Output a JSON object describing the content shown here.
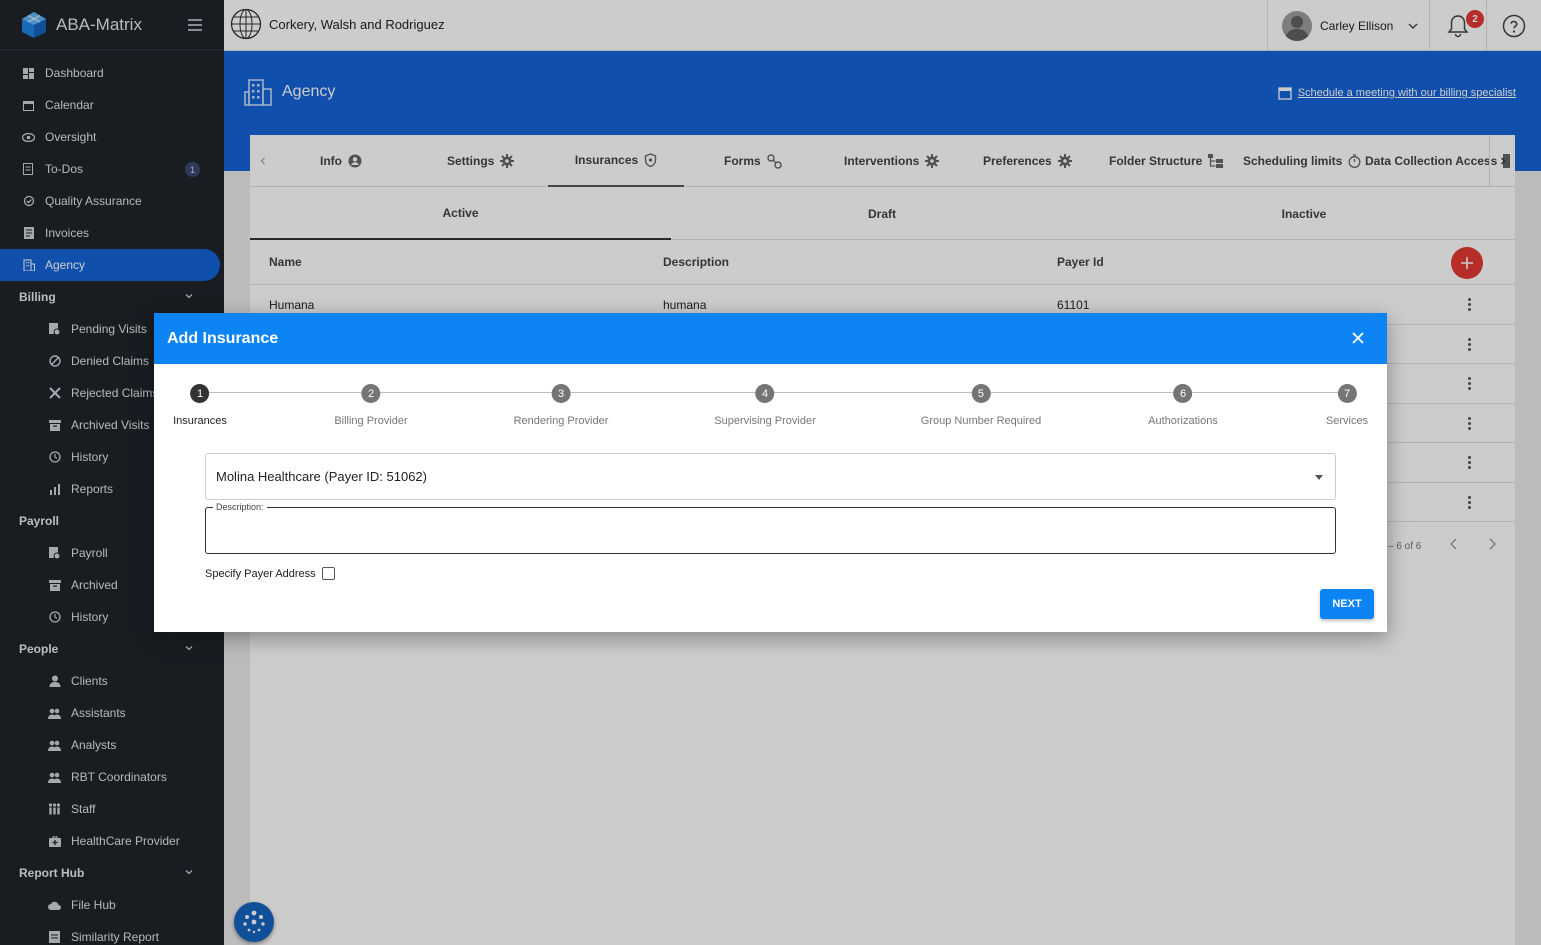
{
  "app": {
    "name": "ABA-Matrix"
  },
  "sidebar": {
    "items": [
      {
        "label": "Dashboard",
        "icon": "dashboard-icon"
      },
      {
        "label": "Calendar",
        "icon": "calendar-icon"
      },
      {
        "label": "Oversight",
        "icon": "eye-icon"
      },
      {
        "label": "To-Dos",
        "icon": "todo-icon",
        "badge": "1"
      },
      {
        "label": "Quality Assurance",
        "icon": "qa-icon"
      },
      {
        "label": "Invoices",
        "icon": "invoice-icon"
      },
      {
        "label": "Agency",
        "icon": "building-icon"
      }
    ],
    "billing": {
      "label": "Billing",
      "items": [
        "Pending Visits",
        "Denied Claims",
        "Rejected Claims",
        "Archived Visits",
        "History",
        "Reports"
      ]
    },
    "payroll": {
      "label": "Payroll",
      "items": [
        "Payroll",
        "Archived",
        "History"
      ]
    },
    "people": {
      "label": "People",
      "items": [
        "Clients",
        "Assistants",
        "Analysts",
        "RBT Coordinators",
        "Staff",
        "HealthCare Provider"
      ]
    },
    "report_hub": {
      "label": "Report Hub",
      "items": [
        "File Hub",
        "Similarity Report"
      ]
    }
  },
  "topbar": {
    "org_name": "Corkery, Walsh and Rodriguez",
    "user_name": "Carley Ellison",
    "notification_count": "2"
  },
  "page": {
    "title": "Agency",
    "schedule_link": "Schedule a meeting with our billing specialist"
  },
  "tabs": [
    "Info",
    "Settings",
    "Insurances",
    "Forms",
    "Interventions",
    "Preferences",
    "Folder Structure",
    "Scheduling limits",
    "Data Collection Access"
  ],
  "subtabs": [
    "Active",
    "Draft",
    "Inactive"
  ],
  "table": {
    "headers": [
      "Name",
      "Description",
      "Payer Id"
    ],
    "rows": [
      {
        "name": "Humana",
        "description": "humana",
        "payer_id": "61101"
      }
    ],
    "pagination": "– 6 of 6"
  },
  "modal": {
    "title": "Add Insurance",
    "steps": [
      "Insurances",
      "Billing Provider",
      "Rendering Provider",
      "Supervising Provider",
      "Group Number Required",
      "Authorizations",
      "Services"
    ],
    "step_numbers": [
      "1",
      "2",
      "3",
      "4",
      "5",
      "6",
      "7"
    ],
    "insurance_select_value": "Molina Healthcare (Payer ID: 51062)",
    "description_label": "Description:",
    "description_value": "",
    "specify_payer_address_label": "Specify Payer Address",
    "next_label": "NEXT"
  },
  "colors": {
    "sidebar_bg": "#20252b",
    "primary_blue": "#1565d8",
    "modal_header": "#0d84f4",
    "danger_red": "#e53935"
  }
}
